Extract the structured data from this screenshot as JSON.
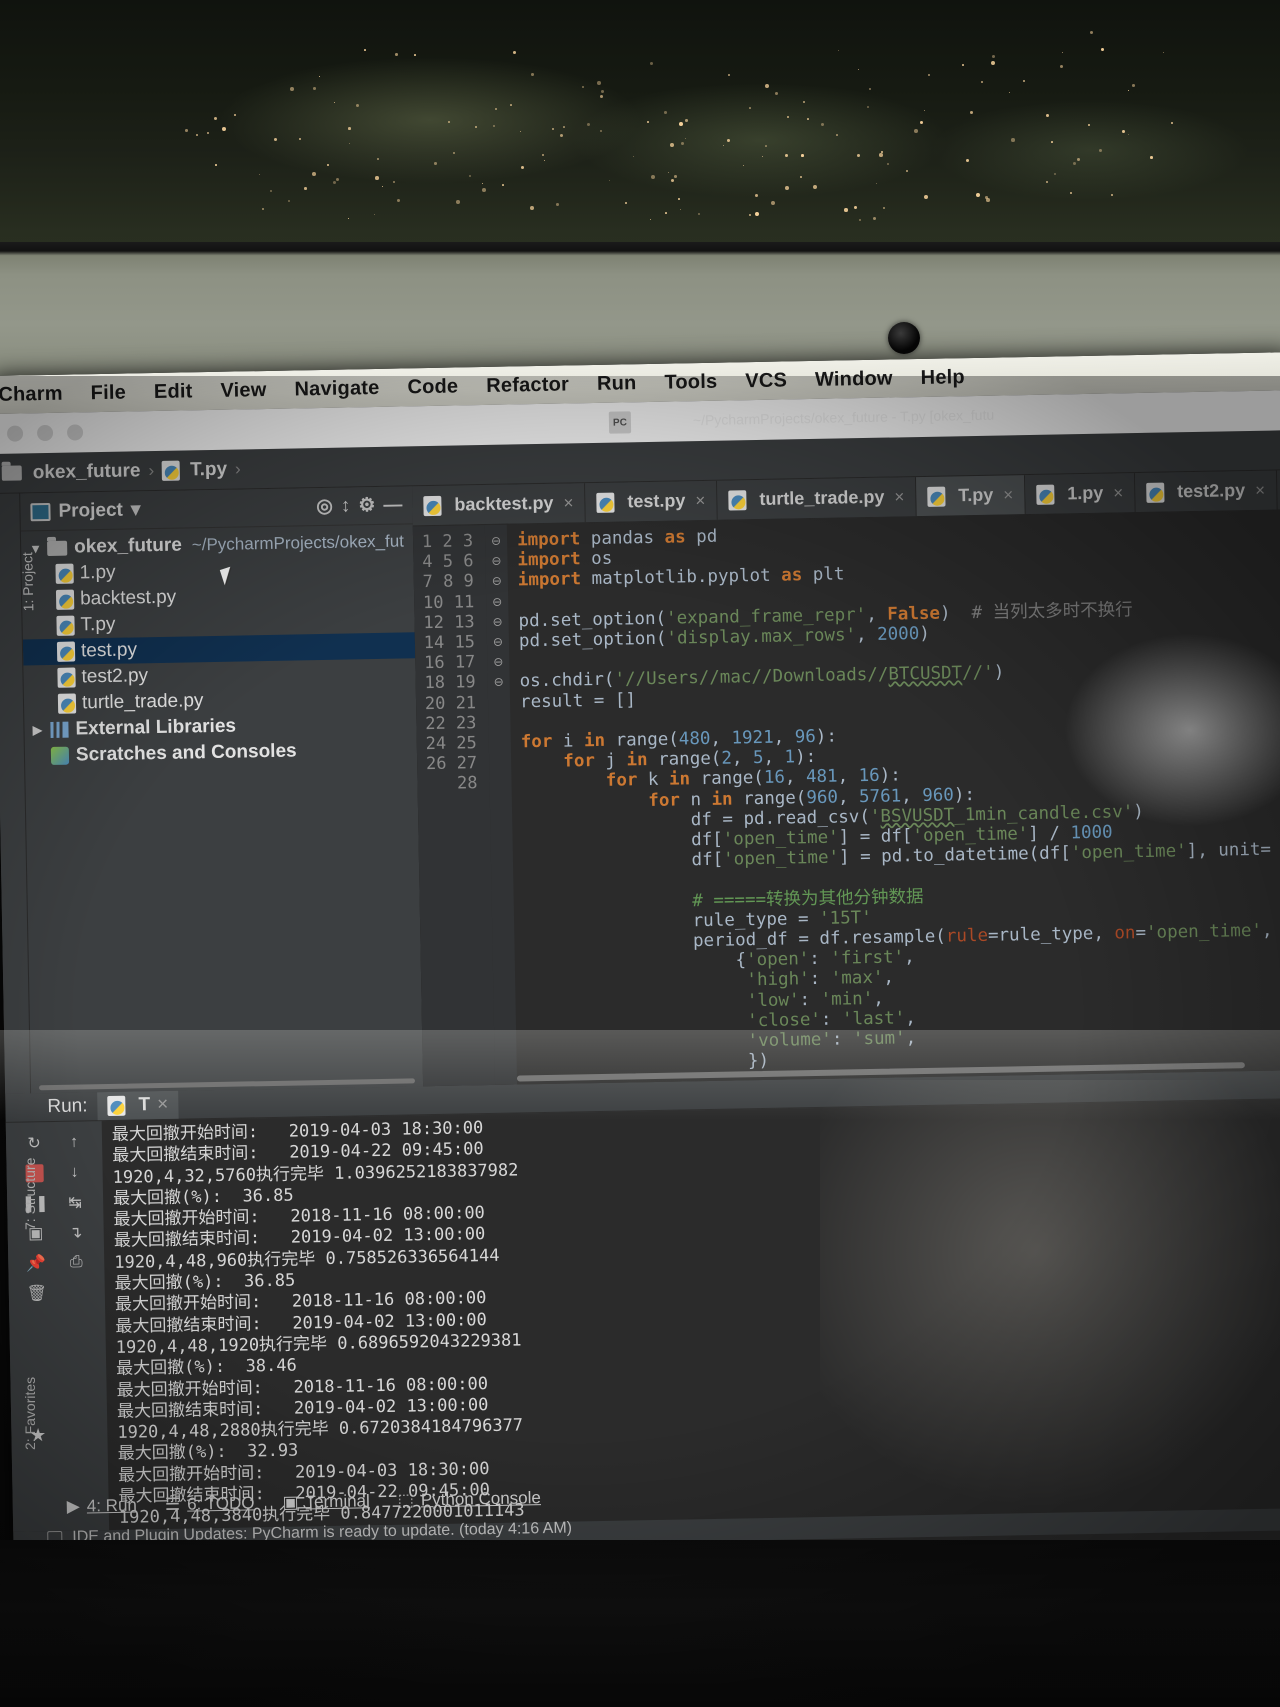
{
  "menubar": {
    "items": [
      "Charm",
      "File",
      "Edit",
      "View",
      "Navigate",
      "Code",
      "Refactor",
      "Run",
      "Tools",
      "VCS",
      "Window",
      "Help"
    ],
    "app_icon": "pycharm-icon",
    "faint_path": "~/PycharmProjects/okex_future   - T.py [okex_futu"
  },
  "breadcrumb": {
    "project": "okex_future",
    "file": "T.py",
    "separator": "›"
  },
  "project_panel": {
    "title": "Project",
    "dropdown_caret": "▾",
    "toolbar_icons": [
      "locate-icon",
      "collapse-all-icon",
      "settings-gear-icon",
      "minimize-icon"
    ],
    "root": {
      "name": "okex_future",
      "path": "~/PycharmProjects/okex_fut",
      "expanded": true
    },
    "files": [
      {
        "name": "1.py",
        "selected": false
      },
      {
        "name": "backtest.py",
        "selected": false
      },
      {
        "name": "T.py",
        "selected": false
      },
      {
        "name": "test.py",
        "selected": true
      },
      {
        "name": "test2.py",
        "selected": false
      },
      {
        "name": "turtle_trade.py",
        "selected": false
      }
    ],
    "external_libraries": "External Libraries",
    "scratches": "Scratches and Consoles"
  },
  "left_rail": {
    "items": [
      "1: Project",
      "7: Structure",
      "2: Favorites"
    ]
  },
  "editor": {
    "tabs": [
      {
        "label": "backtest.py",
        "active": false
      },
      {
        "label": "test.py",
        "active": false
      },
      {
        "label": "turtle_trade.py",
        "active": false
      },
      {
        "label": "T.py",
        "active": true
      },
      {
        "label": "1.py",
        "active": false
      },
      {
        "label": "test2.py",
        "active": false
      }
    ],
    "close_glyph": "×",
    "first_line": 1,
    "last_line": 28,
    "lines": [
      "<span class='kw'>import</span> pandas <span class='kw'>as</span> pd",
      "<span class='kw'>import</span> os",
      "<span class='kw'>import</span> matplotlib.pyplot <span class='kw'>as</span> plt",
      "",
      "pd.set_option(<span class='str'>'expand_frame_repr'</span>, <span class='kw'>False</span>)  <span class='cmt'># 当列太多时不换行</span>",
      "pd.set_option(<span class='str'>'display.max_rows'</span>, <span class='num'>2000</span>)",
      "",
      "os.chdir(<span class='str'>'//Users//mac//Downloads//<span class=\"wavy\">BTCUSDT</span>//'</span>)",
      "result = []",
      "",
      "<span class='kw'>for</span> i <span class='kw'>in</span> range(<span class='num'>480</span>, <span class='num'>1921</span>, <span class='num'>96</span>):",
      "    <span class='kw'>for</span> j <span class='kw'>in</span> range(<span class='num'>2</span>, <span class='num'>5</span>, <span class='num'>1</span>):",
      "        <span class='kw'>for</span> k <span class='kw'>in</span> range(<span class='num'>16</span>, <span class='num'>481</span>, <span class='num'>16</span>):",
      "            <span class='kw'>for</span> n <span class='kw'>in</span> range(<span class='num'>960</span>, <span class='num'>5761</span>, <span class='num'>960</span>):",
      "                df = pd.read_csv(<span class='str'>'<span class=\"wavy\">BSVUSDT</span>_1min_candle.csv'</span>)",
      "                df[<span class='str'>'open_time'</span>] = df[<span class='str'>'open_time'</span>] / <span class='num'>1000</span>",
      "                df[<span class='str'>'open_time'</span>] = pd.to_datetime(df[<span class='str'>'open_time'</span>], unit=",
      "",
      "                <span class='cmt2'># =====转换为其他分钟数据</span>",
      "                rule_type = <span class='str'>'15T'</span>",
      "                period_df = df.resample(<span class='named'>rule</span>=rule_type, <span class='named'>on</span>=<span class='str'>'open_time'</span>,",
      "                    {<span class='str'>'open'</span>: <span class='str'>'first'</span>,",
      "                     <span class='str'>'high'</span>: <span class='str'>'max'</span>,",
      "                     <span class='str'>'low'</span>: <span class='str'>'min'</span>,",
      "                     <span class='str'>'close'</span>: <span class='str'>'last'</span>,",
      "                     <span class='str'>'volume'</span>: <span class='str'>'sum'</span>,",
      "                     })",
      ""
    ]
  },
  "run_panel": {
    "label": "Run:",
    "tab_label": "T",
    "close_glyph": "×",
    "tool_icons": [
      "rerun-icon",
      "up-arrow-icon",
      "stop-icon",
      "down-arrow-icon",
      "pause-icon",
      "soft-wrap-icon",
      "camera-icon",
      "scroll-to-end-icon",
      "pin-icon",
      "print-icon",
      "trash-icon"
    ],
    "output": [
      "最大回撤开始时间:   2019-04-03 18:30:00",
      "最大回撤结束时间:   2019-04-22 09:45:00",
      "1920,4,32,5760执行完毕 1.0396252183837982",
      "最大回撤(%):  36.85",
      "最大回撤开始时间:   2018-11-16 08:00:00",
      "最大回撤结束时间:   2019-04-02 13:00:00",
      "1920,4,48,960执行完毕 0.758526336564144",
      "最大回撤(%):  36.85",
      "最大回撤开始时间:   2018-11-16 08:00:00",
      "最大回撤结束时间:   2019-04-02 13:00:00",
      "1920,4,48,1920执行完毕 0.6896592043229381",
      "最大回撤(%):  38.46",
      "最大回撤开始时间:   2018-11-16 08:00:00",
      "最大回撤结束时间:   2019-04-02 13:00:00",
      "1920,4,48,2880执行完毕 0.6720384184796377",
      "最大回撤(%):  32.93",
      "最大回撤开始时间:   2019-04-03 18:30:00",
      "最大回撤结束时间:   2019-04-22 09:45:00",
      "1920,4,48,3840执行完毕 0.8477220001011143"
    ]
  },
  "bottom_toolbar": {
    "items": [
      {
        "label": "4: Run",
        "icon": "play-icon"
      },
      {
        "label": "6: TODO",
        "icon": "todo-list-icon"
      },
      {
        "label": "Terminal",
        "icon": "terminal-icon"
      },
      {
        "label": "Python Console",
        "icon": "python-console-icon"
      }
    ]
  },
  "status_bar": {
    "message": "IDE and Plugin Updates: PyCharm is ready to update. (today 4:16 AM)",
    "icon": "event-log-icon"
  },
  "colors": {
    "editor_bg": "#2b2b2b",
    "panel_bg": "#3c3f41",
    "gutter_bg": "#313335",
    "selection": "#103050",
    "active_tab": "#4e5254",
    "keyword": "#cc7832",
    "string": "#6a8759",
    "number": "#6897bb",
    "comment": "#808080",
    "text": "#a9b7c6"
  }
}
